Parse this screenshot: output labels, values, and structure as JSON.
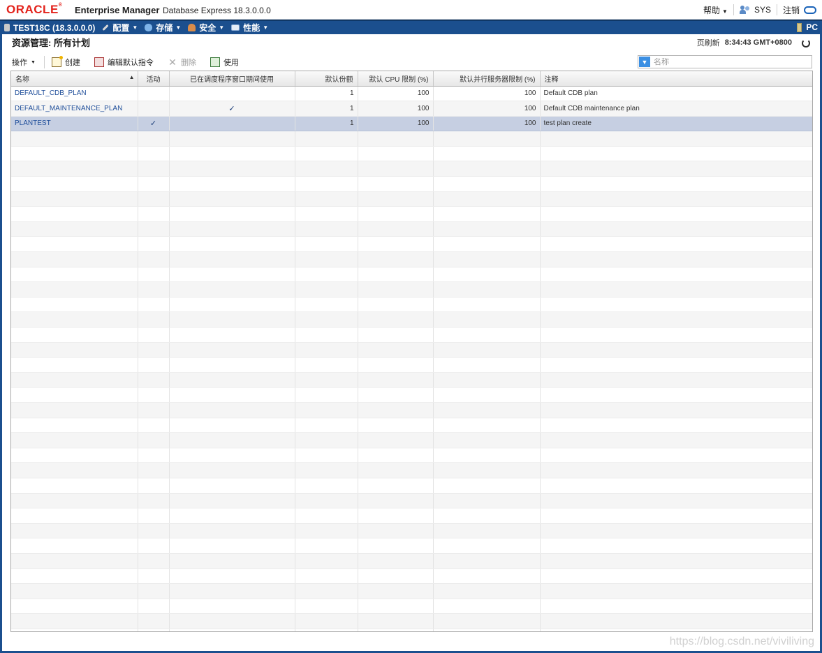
{
  "brand": {
    "logo_text": "ORACLE",
    "product": "Enterprise Manager",
    "subtitle": "Database Express 18.3.0.0.0",
    "help_label": "帮助",
    "user_label": "SYS",
    "logout_label": "注销"
  },
  "nav": {
    "db_label": "TEST18C (18.3.0.0.0)",
    "items": [
      {
        "label": "配置"
      },
      {
        "label": "存储"
      },
      {
        "label": "安全"
      },
      {
        "label": "性能"
      }
    ],
    "right_label": "PC"
  },
  "page": {
    "title": "资源管理: 所有计划",
    "refresh_label": "页刷新",
    "refresh_time": "8:34:43 GMT+0800"
  },
  "toolbar": {
    "actions_label": "操作",
    "create_label": "创建",
    "edit_default_label": "编辑默认指令",
    "delete_label": "删除",
    "use_label": "使用"
  },
  "search": {
    "placeholder": "名称"
  },
  "table": {
    "headers": {
      "name": "名称",
      "active": "活动",
      "used_in_window": "已在调度程序窗口期间使用",
      "default_shares": "默认份额",
      "default_cpu_limit": "默认 CPU 限制 (%)",
      "default_parallel_limit": "默认并行服务器限制 (%)",
      "comment": "注释"
    },
    "rows": [
      {
        "name": "DEFAULT_CDB_PLAN",
        "active": "",
        "used_in_window": "",
        "default_shares": "1",
        "default_cpu_limit": "100",
        "default_parallel_limit": "100",
        "comment": "Default CDB plan"
      },
      {
        "name": "DEFAULT_MAINTENANCE_PLAN",
        "active": "",
        "used_in_window": "✓",
        "default_shares": "1",
        "default_cpu_limit": "100",
        "default_parallel_limit": "100",
        "comment": "Default CDB maintenance plan"
      },
      {
        "name": "PLANTEST",
        "active": "✓",
        "used_in_window": "",
        "default_shares": "1",
        "default_cpu_limit": "100",
        "default_parallel_limit": "100",
        "comment": "test plan create"
      }
    ],
    "selected_row": 2
  },
  "watermark": "https://blog.csdn.net/viviliving",
  "colors": {
    "nav_bg": "#1b4f8e",
    "oracle_red": "#e3231c",
    "link": "#1f4e9a",
    "selected_row": "#c6cfe2"
  }
}
